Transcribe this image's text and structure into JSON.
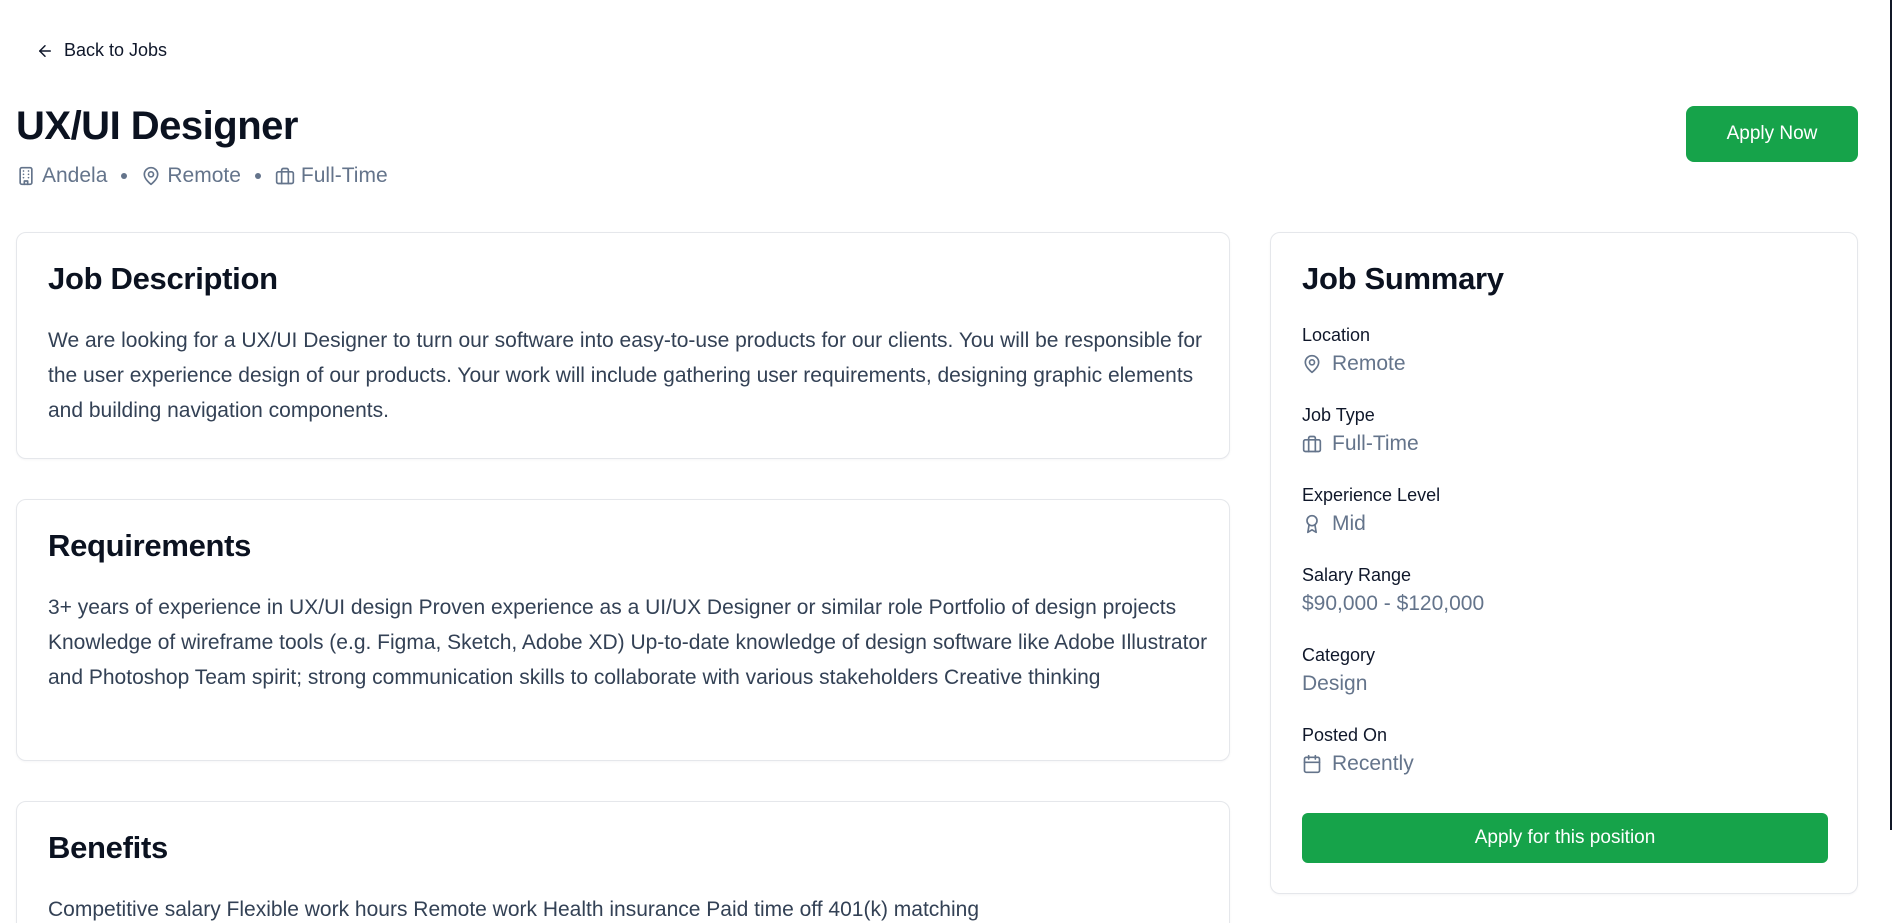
{
  "nav": {
    "back_label": "Back to Jobs"
  },
  "job": {
    "title": "UX/UI Designer",
    "company": "Andela",
    "location": "Remote",
    "type": "Full-Time"
  },
  "header": {
    "apply_label": "Apply Now"
  },
  "description": {
    "title": "Job Description",
    "body": "We are looking for a UX/UI Designer to turn our software into easy-to-use products for our clients. You will be responsible for the user experience design of our products. Your work will include gathering user requirements, designing graphic elements and building navigation components."
  },
  "requirements": {
    "title": "Requirements",
    "body": "3+ years of experience in UX/UI design Proven experience as a UI/UX Designer or similar role Portfolio of design projects Knowledge of wireframe tools (e.g. Figma, Sketch, Adobe XD) Up-to-date knowledge of design software like Adobe Illustrator and Photoshop Team spirit; strong communication skills to collaborate with various stakeholders Creative thinking"
  },
  "benefits": {
    "title": "Benefits",
    "body": "Competitive salary Flexible work hours Remote work Health insurance Paid time off 401(k) matching"
  },
  "summary": {
    "title": "Job Summary",
    "location_label": "Location",
    "location_value": "Remote",
    "type_label": "Job Type",
    "type_value": "Full-Time",
    "experience_label": "Experience Level",
    "experience_value": "Mid",
    "salary_label": "Salary Range",
    "salary_value": "$90,000 - $120,000",
    "category_label": "Category",
    "category_value": "Design",
    "posted_label": "Posted On",
    "posted_value": "Recently",
    "apply_label": "Apply for this position"
  },
  "icons": {
    "back": "arrow-left-icon",
    "company": "building-icon",
    "location": "map-pin-icon",
    "job_type": "briefcase-icon",
    "experience": "award-icon",
    "posted": "calendar-icon"
  },
  "colors": {
    "accent": "#16a34a",
    "muted_text": "#64748b",
    "body_text": "#334155",
    "heading_text": "#0b1220",
    "card_border": "#e5e7eb"
  }
}
